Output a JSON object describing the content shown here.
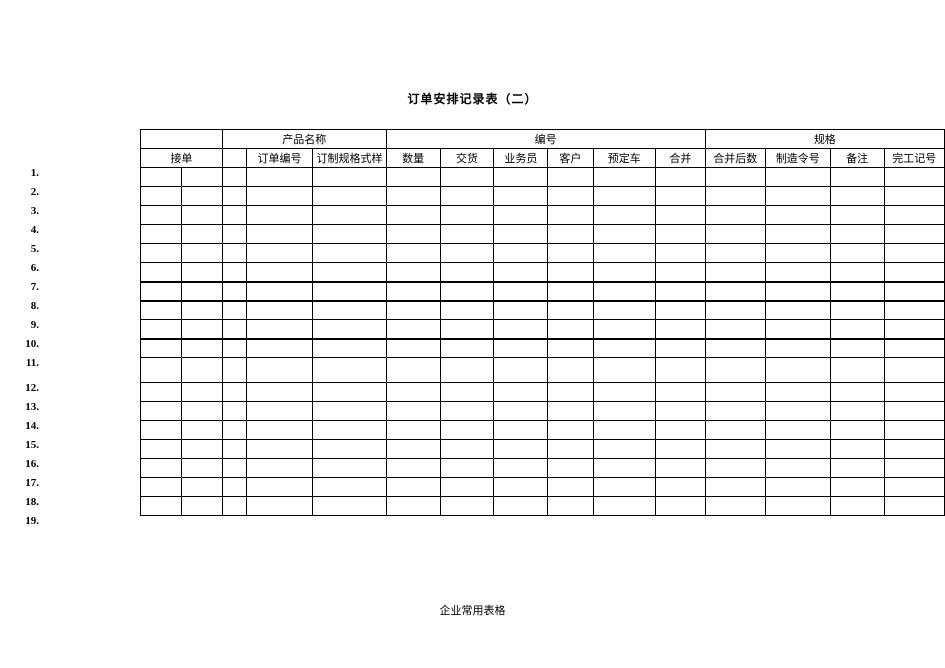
{
  "title": "订单安排记录表（二）",
  "header1": {
    "c1": "产品名称",
    "c2": "编号",
    "c3": "规格"
  },
  "header2": {
    "c0": "接单",
    "c1": "订单编号",
    "c2": "订制规格式样",
    "c3": "数量",
    "c4": "交货",
    "c5": "业务员",
    "c6": "客户",
    "c7": "预定车",
    "c8": "合并",
    "c9": "合并后数",
    "c10": "制造令号",
    "c11": "备注",
    "c12": "完工记号"
  },
  "rownums": [
    "1.",
    "2.",
    "3.",
    "4.",
    "5.",
    "6.",
    "7.",
    "8.",
    "9.",
    "10.",
    "11.",
    "12.",
    "13.",
    "14.",
    "15.",
    "16.",
    "17.",
    "18.",
    "19."
  ],
  "footer": "企业常用表格"
}
